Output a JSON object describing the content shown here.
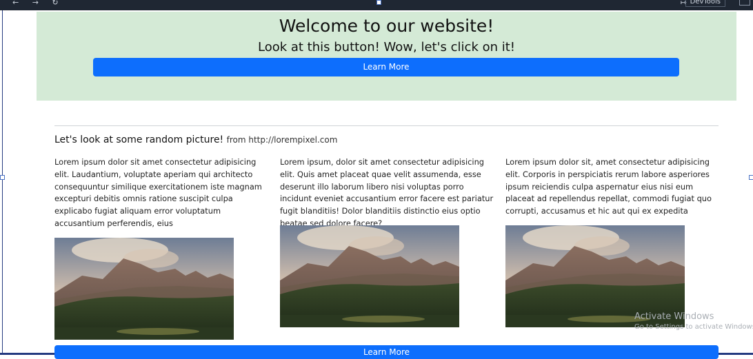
{
  "browser": {
    "nav_icons": "← → ↻",
    "devtools_label": "DevTools",
    "forward_icon": "↦"
  },
  "hero": {
    "title": "Welcome to our website!",
    "subtitle": "Look at this button! Wow, let's click on it!",
    "button_label": "Learn More",
    "background": "#d4ead6",
    "button_color": "#0d6efd"
  },
  "section": {
    "heading": "Let's look at some random picture!",
    "source_text": "from http://lorempixel.com",
    "columns": [
      {
        "text": "Lorem ipsum dolor sit amet consectetur adipisicing elit. Laudantium, voluptate aperiam qui architecto consequuntur similique exercitationem iste magnam excepturi debitis omnis ratione suscipit culpa explicabo fugiat aliquam error voluptatum accusantium perferendis, eius",
        "image": "mountain-landscape"
      },
      {
        "text": "Lorem ipsum, dolor sit amet consectetur adipisicing elit. Quis amet placeat quae velit assumenda, esse deserunt illo laborum libero nisi voluptas porro incidunt eveniet accusantium error facere est pariatur fugit blanditiis! Dolor blanditiis distinctio eius optio beatae sed dolore facere?",
        "image": "mountain-landscape"
      },
      {
        "text": "Lorem ipsum dolor sit, amet consectetur adipisicing elit. Corporis in perspiciatis rerum labore asperiores ipsum reiciendis culpa aspernatur eius nisi eum placeat ad repellendus repellat, commodi fugiat quo corrupti, accusamus et hic aut qui ex expedita",
        "image": "mountain-landscape"
      }
    ],
    "bottom_button_label": "Learn More"
  },
  "watermark": {
    "title": "Activate Windows",
    "subtitle": "Go to Settings to activate Windows."
  }
}
